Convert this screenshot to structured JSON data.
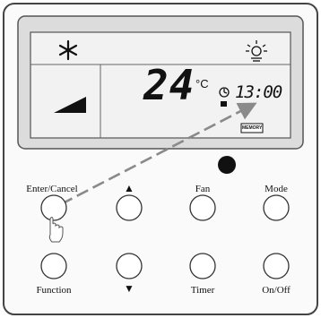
{
  "display": {
    "temperature": "24",
    "temp_unit": "°C",
    "clock": "13:00",
    "memory_badge": "MEMORY"
  },
  "buttons": [
    {
      "id": "enter-cancel",
      "label": "Enter/Cancel"
    },
    {
      "id": "up",
      "label": "▲"
    },
    {
      "id": "fan",
      "label": "Fan"
    },
    {
      "id": "mode",
      "label": "Mode"
    },
    {
      "id": "function",
      "label": "Function"
    },
    {
      "id": "down",
      "label": "▼"
    },
    {
      "id": "timer",
      "label": "Timer"
    },
    {
      "id": "on-off",
      "label": "On/Off"
    }
  ],
  "colors": {
    "panel_outline": "#555555",
    "lcd_background": "#f2f2f2",
    "arrow": "#8a8a8a",
    "text": "#111111"
  },
  "icons": [
    "snowflake-icon",
    "sun-icon",
    "clock-icon",
    "signal-bars-icon",
    "pointing-hand-icon"
  ]
}
